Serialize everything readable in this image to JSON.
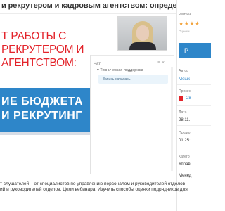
{
  "header": {
    "title": "и рекрутером и кадровым агентством: определение бюджета на"
  },
  "slide": {
    "lines": [
      "Т РАБОТЫ С",
      "РЕКРУТЕРОМ И",
      "АГЕНТСТВОМ:"
    ],
    "band_lines": [
      "ИЕ БЮДЖЕТА",
      "И РЕКРУТИНГ"
    ]
  },
  "chat": {
    "label": "Чат",
    "controls": "≡  ×",
    "support_name": "Техническая поддержка",
    "message": "Запись началась."
  },
  "sidebar": {
    "rating_label": "Рейтин",
    "stars": "★★★★",
    "stars_caption": "Оценки",
    "button_label": "Р",
    "author_label": "Автор",
    "author_value": "Мешк",
    "presentation_label": "Презен",
    "presentation_value": "28",
    "date_label": "Дата",
    "date_value": "28.11.",
    "duration_label": "Продол",
    "duration_value": "01:25:",
    "category_label": "Катего",
    "category_value": "Управ",
    "extra_value": "Менед"
  },
  "description": {
    "lines": [
      "т слушателей – от специалистов по управлению персоналом и руководителей отделов",
      "ий и руководителей отделов. Цели вебинара: Изучить способы оценки подрядчиков для"
    ]
  },
  "colors": {
    "accent": "#2e86c9",
    "slide_text": "#e3232a",
    "stars": "#f2a23a"
  }
}
